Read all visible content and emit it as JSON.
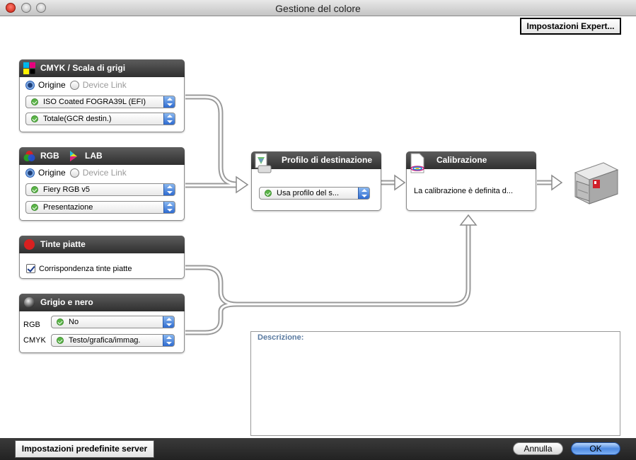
{
  "window": {
    "title": "Gestione del colore"
  },
  "toolbar": {
    "expert_label": "Impostazioni Expert..."
  },
  "cmyk_panel": {
    "title": "CMYK / Scala di grigi",
    "radio_origin": "Origine",
    "radio_devicelink": "Device Link",
    "select_profile": "ISO Coated FOGRA39L (EFI)",
    "select_mode": "Totale(GCR destin.)"
  },
  "rgb_panel": {
    "title_rgb": "RGB",
    "title_lab": "LAB",
    "radio_origin": "Origine",
    "radio_devicelink": "Device Link",
    "select_profile": "Fiery RGB v5",
    "select_mode": "Presentazione"
  },
  "spot_panel": {
    "title": "Tinte piatte",
    "checkbox_label": "Corrispondenza tinte piatte",
    "checked": true
  },
  "gray_panel": {
    "title": "Grigio e nero",
    "rgb_label": "RGB",
    "rgb_value": "No",
    "cmyk_label": "CMYK",
    "cmyk_value": "Testo/grafica/immag."
  },
  "dest_panel": {
    "title": "Profilo di destinazione",
    "select_value": "Usa profilo del s..."
  },
  "calib_panel": {
    "title": "Calibrazione",
    "text": "La calibrazione è definita d..."
  },
  "description": {
    "label": "Descrizione:"
  },
  "footer": {
    "server_defaults_label": "Impostazioni predefinite server",
    "cancel_label": "Annulla",
    "ok_label": "OK"
  },
  "colors": {
    "accent": "#3b78d8",
    "header_bg": "#3a3a3a",
    "check_green": "#5bb548"
  }
}
